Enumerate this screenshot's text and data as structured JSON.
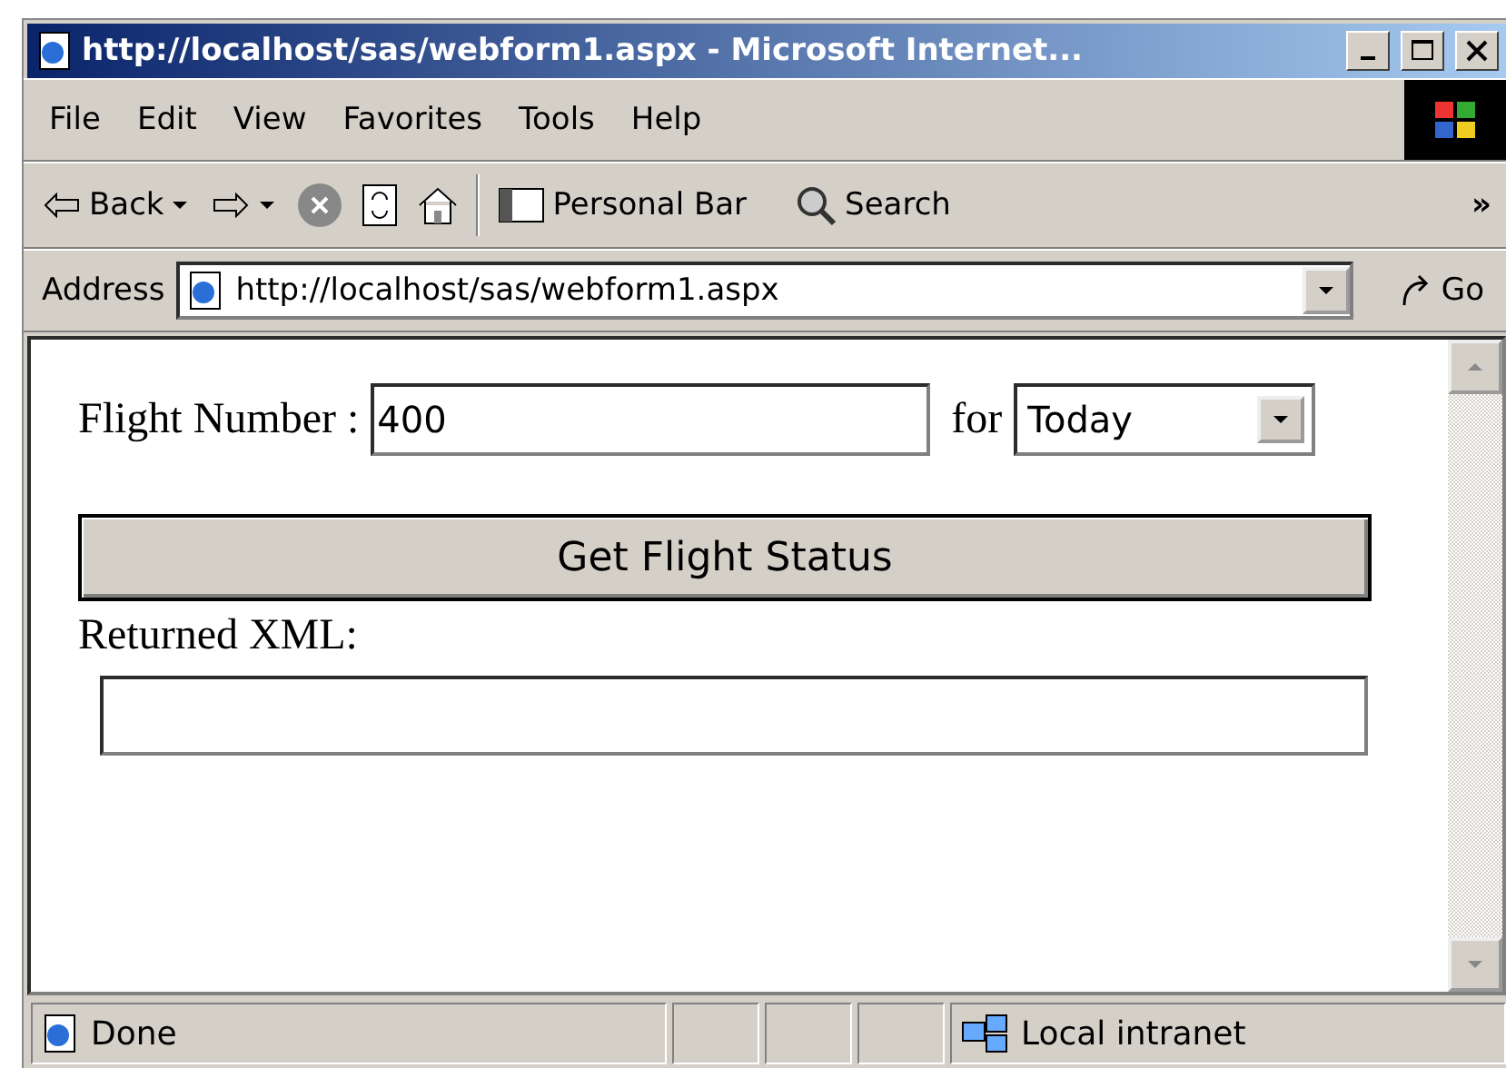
{
  "window": {
    "title": "http://localhost/sas/webform1.aspx - Microsoft Internet..."
  },
  "menu": [
    "File",
    "Edit",
    "View",
    "Favorites",
    "Tools",
    "Help"
  ],
  "toolbar": {
    "back": "Back",
    "personal_bar": "Personal Bar",
    "search": "Search",
    "more": "»"
  },
  "address": {
    "label": "Address",
    "value": "http://localhost/sas/webform1.aspx",
    "go": "Go"
  },
  "form": {
    "flight_label": "Flight Number :",
    "flight_value": "400",
    "for_label": "for",
    "day": "Today",
    "button": "Get Flight Status",
    "xml_label": "Returned XML:"
  },
  "status_bar": {
    "text": "Done",
    "zone": "Local intranet"
  }
}
